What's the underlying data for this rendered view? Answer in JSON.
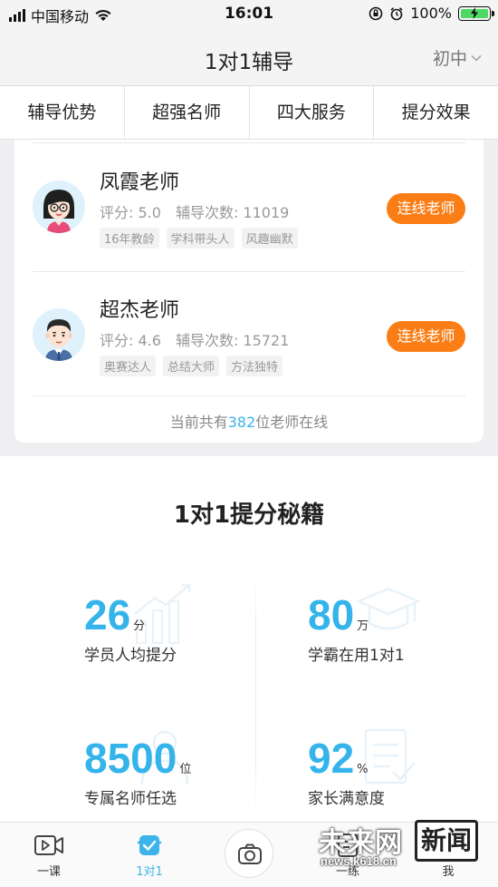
{
  "status_bar": {
    "carrier": "中国移动",
    "time": "16:01",
    "battery": "100%"
  },
  "nav": {
    "title": "1对1辅导",
    "grade": "初中"
  },
  "tabs": [
    "辅导优势",
    "超强名师",
    "四大服务",
    "提分效果"
  ],
  "teachers": [
    {
      "name": "凤霞老师",
      "score_label": "评分: 5.0",
      "count_label": "辅导次数: 11019",
      "tags": [
        "16年教龄",
        "学科带头人",
        "风趣幽默"
      ],
      "button": "连线老师"
    },
    {
      "name": "超杰老师",
      "score_label": "评分: 4.6",
      "count_label": "辅导次数: 15721",
      "tags": [
        "奥赛达人",
        "总结大师",
        "方法独特"
      ],
      "button": "连线老师"
    }
  ],
  "online": {
    "prefix": "当前共有",
    "count": "382",
    "suffix": "位老师在线"
  },
  "secrets": {
    "title": "1对1提分秘籍",
    "stats": [
      {
        "value": "26",
        "unit": "分",
        "label": "学员人均提分",
        "icon": "growth-chart-icon"
      },
      {
        "value": "80",
        "unit": "万",
        "label": "学霸在用1对1",
        "icon": "graduation-cap-icon"
      },
      {
        "value": "8500",
        "unit": "位",
        "label": "专属名师任选",
        "icon": "teacher-icon"
      },
      {
        "value": "92",
        "unit": "%",
        "label": "家长满意度",
        "icon": "checklist-icon"
      }
    ]
  },
  "tabbar": {
    "items": [
      {
        "label": "一课",
        "icon": "video-icon"
      },
      {
        "label": "1对1",
        "icon": "tutor-icon"
      },
      {
        "label": "一练",
        "icon": "practice-icon"
      },
      {
        "label": "我",
        "icon": "profile-icon"
      }
    ]
  },
  "watermark": {
    "brand": "未来网",
    "news": "新闻",
    "url": "news.k618.cn"
  },
  "colors": {
    "accent_blue": "#34b4ea",
    "button_orange": "#fb7d16",
    "battery_green": "#4cd964"
  }
}
